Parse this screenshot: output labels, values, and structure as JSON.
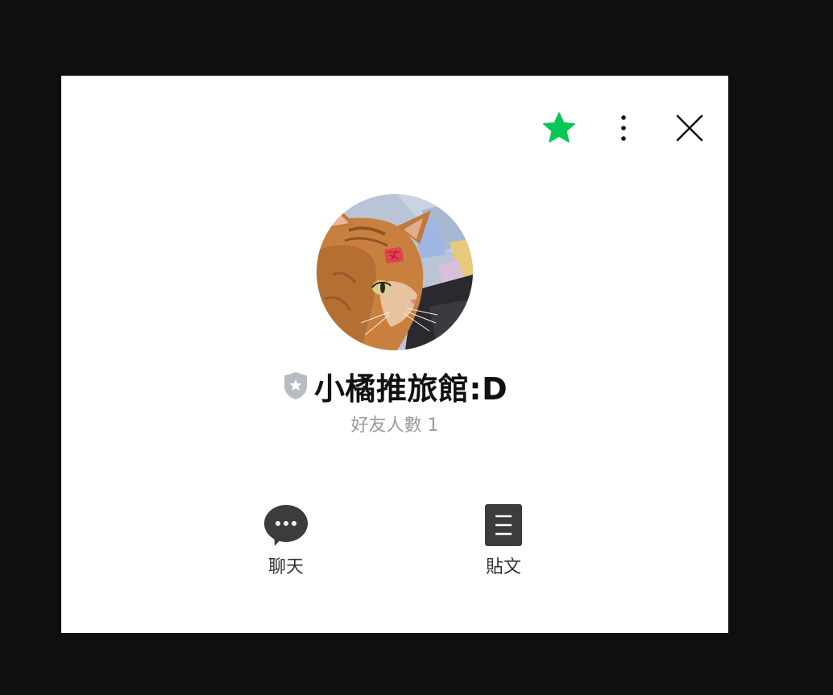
{
  "profile": {
    "name": "小橘推旅館:D",
    "friend_count": "好友人數 1",
    "verified_badge_icon": "shield-star-icon"
  },
  "header_actions": {
    "favorite_icon": "star-icon",
    "more_icon": "vertical-dots-icon",
    "close_icon": "close-icon"
  },
  "actions": {
    "chat": {
      "label": "聊天",
      "icon": "chat-bubble-icon"
    },
    "post": {
      "label": "貼文",
      "icon": "document-icon"
    }
  },
  "colors": {
    "favorite_star": "#06c755",
    "badge": "#b7bcc2",
    "icon_dark": "#3c3c3f",
    "backdrop": "#0f0f0f"
  }
}
